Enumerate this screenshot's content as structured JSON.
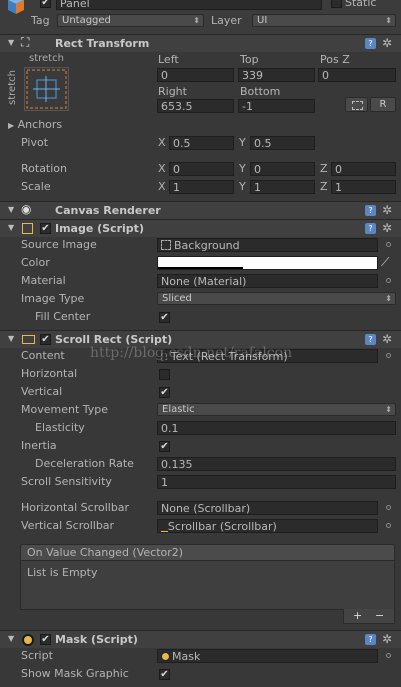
{
  "header": {
    "object_name": "Panel",
    "static_label": "Static",
    "tag_label": "Tag",
    "tag_value": "Untagged",
    "layer_label": "Layer",
    "layer_value": "UI"
  },
  "rect_transform": {
    "title": "Rect Transform",
    "anchor_preset": "stretch",
    "col1_label": "Left",
    "col2_label": "Top",
    "col3_label": "Pos Z",
    "left": "0",
    "top": "339",
    "pos_z": "0",
    "right_label": "Right",
    "bottom_label": "Bottom",
    "right": "653.5",
    "bottom": "-1",
    "r_button": "R",
    "anchors_label": "Anchors",
    "pivot_label": "Pivot",
    "pivot_x": "0.5",
    "pivot_y": "0.5",
    "rotation_label": "Rotation",
    "rot_x": "0",
    "rot_y": "0",
    "rot_z": "0",
    "scale_label": "Scale",
    "scale_x": "1",
    "scale_y": "1",
    "scale_z": "1",
    "x": "X",
    "y": "Y",
    "z": "Z"
  },
  "canvas_renderer": {
    "title": "Canvas Renderer"
  },
  "image": {
    "title": "Image (Script)",
    "source_image_label": "Source Image",
    "source_image": "Background",
    "color_label": "Color",
    "material_label": "Material",
    "material": "None (Material)",
    "image_type_label": "Image Type",
    "image_type": "Sliced",
    "fill_center_label": "Fill Center"
  },
  "scroll_rect": {
    "title": "Scroll Rect (Script)",
    "content_label": "Content",
    "content": "Text (Rect Transform)",
    "horizontal_label": "Horizontal",
    "vertical_label": "Vertical",
    "movement_label": "Movement Type",
    "movement": "Elastic",
    "elasticity_label": "Elasticity",
    "elasticity": "0.1",
    "inertia_label": "Inertia",
    "decel_label": "Deceleration Rate",
    "decel": "0.135",
    "sensitivity_label": "Scroll Sensitivity",
    "sensitivity": "1",
    "hscroll_label": "Horizontal Scrollbar",
    "hscroll": "None (Scrollbar)",
    "vscroll_label": "Vertical Scrollbar",
    "vscroll": "Scrollbar (Scrollbar)",
    "event_title": "On Value Changed (Vector2)",
    "event_empty": "List is Empty",
    "plus": "+",
    "minus": "−"
  },
  "mask": {
    "title": "Mask (Script)",
    "script_label": "Script",
    "script": "Mask",
    "show_graphic_label": "Show Mask Graphic"
  },
  "watermark": "http://blog.csdn.net/rafalcon",
  "colors": {
    "bg": "#383838",
    "header": "#404040",
    "field": "#2b2b2b",
    "help": "#5b86c4",
    "color_swatch": "#ffffff"
  }
}
